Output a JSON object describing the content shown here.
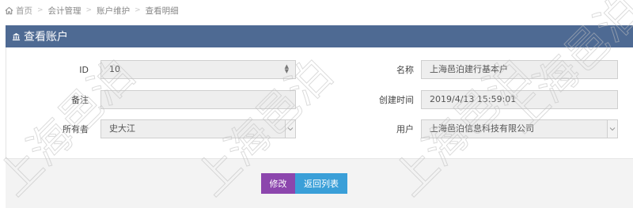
{
  "breadcrumb": {
    "items": [
      "首页",
      "会计管理",
      "账户维护",
      "查看明细"
    ]
  },
  "panel": {
    "title": "查看账户"
  },
  "form": {
    "id_label": "ID",
    "id_value": "10",
    "name_label": "名称",
    "name_value": "上海邑泊建行基本户",
    "remark_label": "备注",
    "remark_value": "",
    "created_label": "创建时间",
    "created_value": "2019/4/13 15:59:01",
    "owner_label": "所有者",
    "owner_value": "史大江",
    "user_label": "用户",
    "user_value": "上海邑泊信息科技有限公司"
  },
  "buttons": {
    "edit_label": "修改",
    "back_label": "返回列表"
  },
  "watermark": {
    "text": "上海邑泊"
  },
  "colors": {
    "header_bg": "#4e6a93",
    "edit_btn": "#8c46ad",
    "back_btn": "#3a9fd8",
    "field_bg": "#eeeeee",
    "footer_bg": "#f3f3f3"
  }
}
